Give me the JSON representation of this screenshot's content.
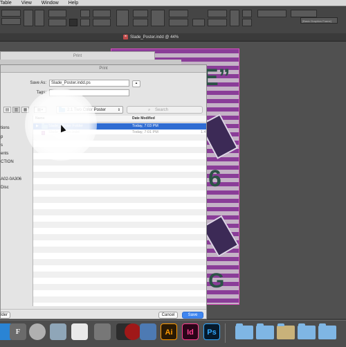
{
  "menu": [
    "Table",
    "View",
    "Window",
    "Help"
  ],
  "control_bar": {
    "style_field": "[Basic Graphics Frame]"
  },
  "document_tab": {
    "title": "Slade_Poster.indd @ 44%"
  },
  "print_panel": {
    "title": "Print"
  },
  "dialog": {
    "title": "Print",
    "save_as_label": "Save As:",
    "save_as_value": "Slade_Poster.indd.ps",
    "tags_label": "Tags:",
    "location": "2.1 Two Color Poster",
    "search_placeholder": "Search",
    "column_name": "Name",
    "column_date": "Date Modified",
    "rows": [
      {
        "name": "Slade_Poster Folder",
        "date": "Today, 7:03 PM",
        "type": "folder",
        "selected": true
      },
      {
        "name": "Slade_Poster.indd",
        "date": "Today, 7:01 PM",
        "size": "1.4",
        "type": "indd",
        "selected": false
      }
    ],
    "sidebar": [
      "tions",
      "p",
      "s",
      "ents",
      "CTION",
      "A02-0A306",
      "Disc"
    ],
    "new_folder_partial": "lder",
    "cancel_label": "Cancel",
    "save_label": "Save"
  },
  "poster": {
    "text_top": "E”",
    "text_mid": "6",
    "text_bottom": "G"
  },
  "colors": {
    "accent": "#2f6cd2",
    "poster_purple": "#8a3d98",
    "poster_green": "#2c5246"
  },
  "dock": {
    "apps": [
      {
        "name": "finder-icon",
        "label": ""
      },
      {
        "name": "font-book-icon",
        "label": "F"
      },
      {
        "name": "rocket-icon",
        "label": ""
      },
      {
        "name": "preview-icon",
        "label": ""
      },
      {
        "name": "photos-icon",
        "label": ""
      },
      {
        "name": "imovie-icon",
        "label": ""
      },
      {
        "name": "terminal-icon",
        "label": ""
      },
      {
        "name": "photo-booth-icon",
        "label": ""
      },
      {
        "name": "screen-record-icon",
        "label": ""
      },
      {
        "name": "airplane-icon",
        "label": ""
      },
      {
        "name": "illustrator-icon",
        "label": "Ai"
      },
      {
        "name": "indesign-icon",
        "label": "Id"
      },
      {
        "name": "photoshop-icon",
        "label": "Ps"
      }
    ]
  }
}
